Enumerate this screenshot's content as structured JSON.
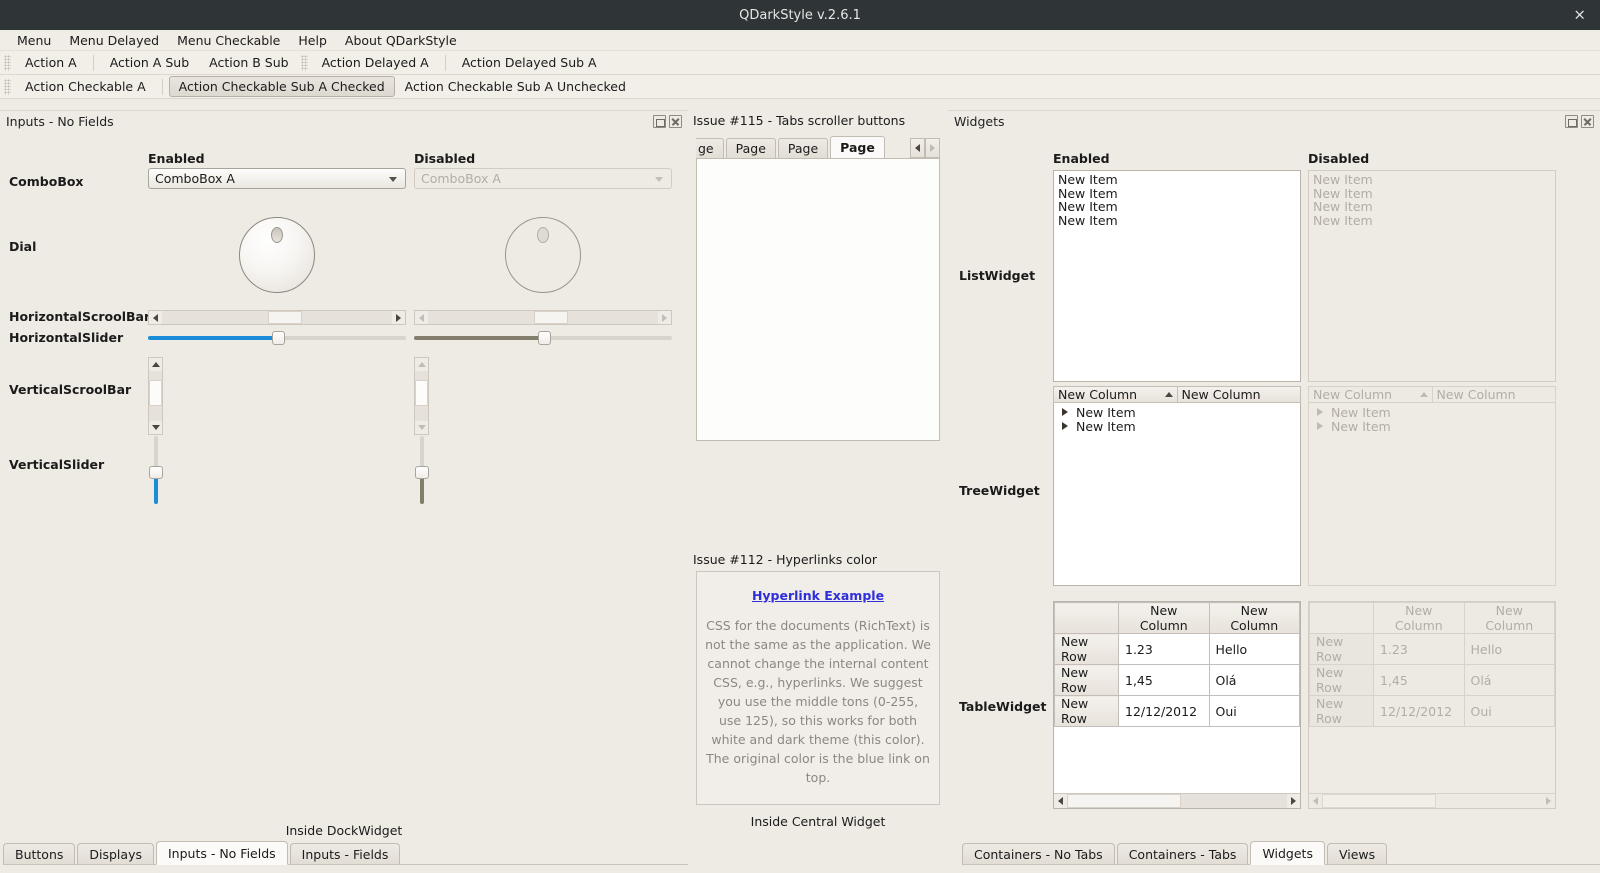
{
  "window": {
    "title": "QDarkStyle v.2.6.1",
    "close_label": "×"
  },
  "menubar": {
    "items": [
      "Menu",
      "Menu Delayed",
      "Menu Checkable",
      "Help",
      "About QDarkStyle"
    ]
  },
  "toolbar1": {
    "actions": [
      "Action A",
      "Action A Sub",
      "Action B Sub",
      "Action Delayed A",
      "Action Delayed Sub A"
    ]
  },
  "toolbar2": {
    "actions": [
      {
        "label": "Action Checkable A",
        "checked": false
      },
      {
        "label": "Action Checkable Sub A Checked",
        "checked": true
      },
      {
        "label": "Action Checkable Sub A Unchecked",
        "checked": false
      }
    ]
  },
  "left_dock": {
    "title": "Inputs - No Fields",
    "column_headers": {
      "enabled": "Enabled",
      "disabled": "Disabled"
    },
    "rows": {
      "combobox": {
        "label": "ComboBox",
        "enabled_value": "ComboBox A",
        "disabled_value": "ComboBox A"
      },
      "dial": {
        "label": "Dial"
      },
      "hscrollbar": {
        "label": "HorizontalScroolBar"
      },
      "hslider": {
        "label": "HorizontalSlider"
      },
      "vscrollbar": {
        "label": "VerticalScroolBar"
      },
      "vslider": {
        "label": "VerticalSlider"
      }
    },
    "footer": "Inside DockWidget",
    "tabs": [
      {
        "label": "Buttons",
        "selected": false
      },
      {
        "label": "Displays",
        "selected": false
      },
      {
        "label": "Inputs - No Fields",
        "selected": true
      },
      {
        "label": "Inputs - Fields",
        "selected": false
      }
    ],
    "accent": "#1a8cd8",
    "disabled_accent": "#837e6b"
  },
  "central": {
    "issue115": {
      "title": "Issue #115 - Tabs scroller buttons",
      "tabs": [
        {
          "label": "ge",
          "selected": false
        },
        {
          "label": "Page",
          "selected": false
        },
        {
          "label": "Page",
          "selected": false
        },
        {
          "label": "Page",
          "selected": true
        }
      ],
      "scroll_left": "◀",
      "scroll_right": "▶"
    },
    "issue112": {
      "title": "Issue #112 - Hyperlinks color",
      "link_text": "Hyperlink Example",
      "body": "CSS for the documents (RichText) is not the same as the application. We cannot change the internal content CSS, e.g., hyperlinks. We suggest you use the middle tons (0-255, use 125), so this works for both white and dark theme (this color). The original color is the blue link on top.",
      "link_color": "#2e2eda",
      "body_color": "#8c8880"
    },
    "footer": "Inside Central Widget"
  },
  "right_dock": {
    "title": "Widgets",
    "column_headers": {
      "enabled": "Enabled",
      "disabled": "Disabled"
    },
    "list_widget": {
      "label": "ListWidget",
      "enabled_items": [
        "New Item",
        "New Item",
        "New Item",
        "New Item"
      ],
      "disabled_items": [
        "New Item",
        "New Item",
        "New Item",
        "New Item"
      ]
    },
    "tree_widget": {
      "label": "TreeWidget",
      "columns": [
        "New Column",
        "New Column"
      ],
      "enabled_rows": [
        "New Item",
        "New Item"
      ],
      "disabled_rows": [
        "New Item",
        "New Item"
      ]
    },
    "table_widget": {
      "label": "TableWidget",
      "columns": [
        "New Column",
        "New Column"
      ],
      "rows": [
        {
          "header": "New Row",
          "cells": [
            "1.23",
            "Hello"
          ]
        },
        {
          "header": "New Row",
          "cells": [
            "1,45",
            "Olá"
          ]
        },
        {
          "header": "New Row",
          "cells": [
            "12/12/2012",
            "Oui"
          ]
        }
      ]
    },
    "tabs": [
      {
        "label": "Containers - No Tabs",
        "selected": false
      },
      {
        "label": "Containers - Tabs",
        "selected": false
      },
      {
        "label": "Widgets",
        "selected": true
      },
      {
        "label": "Views",
        "selected": false
      }
    ]
  },
  "icons": {
    "dock_float": "float-restore-icon",
    "dock_close": "close-icon",
    "sort_ascending": "sort-ascending-icon"
  }
}
